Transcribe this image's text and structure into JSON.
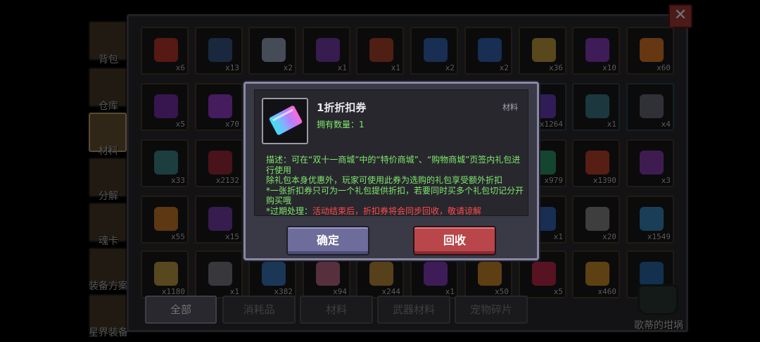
{
  "close_glyph": "✕",
  "side_tabs": [
    {
      "label": "背包",
      "icon": "chest-icon",
      "active": false
    },
    {
      "label": "仓库",
      "icon": "storage-chest-icon",
      "active": false
    },
    {
      "label": "材料",
      "icon": "material-box-icon",
      "active": true
    },
    {
      "label": "分解",
      "icon": "dismantle-icon",
      "active": false
    },
    {
      "label": "魂卡",
      "icon": "soul-card-icon",
      "active": false
    },
    {
      "label": "装备方案",
      "icon": "equipment-plan-icon",
      "active": false
    },
    {
      "label": "星界装备",
      "icon": "astral-gear-icon",
      "active": false
    }
  ],
  "grid_rows": [
    [
      {
        "count": "x6",
        "icon": "red-gem-icon",
        "color": "#c0392b"
      },
      {
        "count": "x13",
        "icon": "banner-icon",
        "color": "#3b5a8a"
      },
      {
        "count": "x2",
        "icon": "scroll-icon",
        "color": "#9aa6c0"
      },
      {
        "count": "x1",
        "icon": "purple-sigil-icon",
        "color": "#7a3fb0"
      },
      {
        "count": "x1",
        "icon": "treasure-chest-icon",
        "color": "#b0452e"
      },
      {
        "count": "x2",
        "icon": "blue-chest-icon",
        "color": "#3567b8"
      },
      {
        "count": "x2",
        "icon": "blue-chest-icon",
        "color": "#3567b8"
      },
      {
        "count": "x36",
        "icon": "gold-medallion-icon",
        "color": "#c8a040"
      },
      {
        "count": "x10",
        "icon": "wizard-hat-icon",
        "color": "#8a3fc0"
      },
      {
        "count": "x60",
        "icon": "campfire-icon",
        "color": "#e07a2a"
      }
    ],
    [
      {
        "count": "x5",
        "icon": "purple-potion-icon",
        "color": "#7a2fb0"
      },
      {
        "count": "x70",
        "icon": "purple-crystal-icon",
        "color": "#9a3fd0"
      },
      {
        "count": "",
        "icon": "empty-icon",
        "color": "#1a1a1c"
      },
      {
        "count": "",
        "icon": "empty-icon",
        "color": "#1a1a1c"
      },
      {
        "count": "",
        "icon": "empty-icon",
        "color": "#1a1a1c"
      },
      {
        "count": "",
        "icon": "empty-icon",
        "color": "#1a1a1c"
      },
      {
        "count": "",
        "icon": "empty-icon",
        "color": "#1a1a1c"
      },
      {
        "count": "x1264",
        "icon": "violet-shard-icon",
        "color": "#6a3fc0"
      },
      {
        "count": "x1",
        "icon": "tablet-icon",
        "color": "#3f7a8a"
      },
      {
        "count": "x4",
        "icon": "machine-icon",
        "color": "#6a6a7a"
      }
    ],
    [
      {
        "count": "x33",
        "icon": "star-jar-icon",
        "color": "#3f8a8a"
      },
      {
        "count": "x2132",
        "icon": "red-ore-icon",
        "color": "#a02a3a"
      },
      {
        "count": "",
        "icon": "empty-icon",
        "color": "#1a1a1c"
      },
      {
        "count": "",
        "icon": "empty-icon",
        "color": "#1a1a1c"
      },
      {
        "count": "",
        "icon": "empty-icon",
        "color": "#1a1a1c"
      },
      {
        "count": "",
        "icon": "empty-icon",
        "color": "#1a1a1c"
      },
      {
        "count": "",
        "icon": "empty-icon",
        "color": "#1a1a1c"
      },
      {
        "count": "x979",
        "icon": "green-gem-icon",
        "color": "#2a9a6a"
      },
      {
        "count": "x1390",
        "icon": "red-rune-icon",
        "color": "#c0452e"
      },
      {
        "count": "x3",
        "icon": "purple-rune-icon",
        "color": "#8a3fb0"
      }
    ],
    [
      {
        "count": "x55",
        "icon": "orange-amulet-icon",
        "color": "#d07a2a"
      },
      {
        "count": "x15",
        "icon": "purple-amulet-icon",
        "color": "#7a3fb0"
      },
      {
        "count": "",
        "icon": "empty-icon",
        "color": "#1a1a1c"
      },
      {
        "count": "",
        "icon": "empty-icon",
        "color": "#1a1a1c"
      },
      {
        "count": "",
        "icon": "empty-icon",
        "color": "#1a1a1c"
      },
      {
        "count": "",
        "icon": "empty-icon",
        "color": "#1a1a1c"
      },
      {
        "count": "",
        "icon": "empty-icon",
        "color": "#1a1a1c"
      },
      {
        "count": "x1",
        "icon": "blue-shard-icon",
        "color": "#3567b8"
      },
      {
        "count": "x20",
        "icon": "pearl-icon",
        "color": "#8a8a8a"
      },
      {
        "count": "x1549",
        "icon": "crystal-cluster-icon",
        "color": "#3a8ac0"
      }
    ],
    [
      {
        "count": "x1180",
        "icon": "gold-star-icon",
        "color": "#c0a040"
      },
      {
        "count": "x1",
        "icon": "gray-crystal-icon",
        "color": "#7a7a86"
      },
      {
        "count": "x382",
        "icon": "blue-ring-icon",
        "color": "#3a7ac0"
      },
      {
        "count": "x94",
        "icon": "pink-petal-icon",
        "color": "#c06a8a"
      },
      {
        "count": "x244",
        "icon": "gold-medal-icon",
        "color": "#c0903a"
      },
      {
        "count": "x1",
        "icon": "purple-flame-icon",
        "color": "#8a3fc0"
      },
      {
        "count": "x50",
        "icon": "orange-star-icon",
        "color": "#d08a2a"
      },
      {
        "count": "x5",
        "icon": "red-crystal-icon",
        "color": "#c02a4a"
      },
      {
        "count": "x460",
        "icon": "amber-shard-icon",
        "color": "#d0902a"
      },
      {
        "count": "",
        "icon": "blue-crystal-icon",
        "color": "#2a6ab0"
      }
    ]
  ],
  "filter_tabs": [
    {
      "label": "全部",
      "active": true
    },
    {
      "label": "消耗品",
      "active": false
    },
    {
      "label": "材料",
      "active": false
    },
    {
      "label": "武器材料",
      "active": false
    },
    {
      "label": "宠物碎片",
      "active": false
    }
  ],
  "npc_label": "歌蒂的坩埚",
  "dialog": {
    "item_name": "1折折扣券",
    "item_type": "材料",
    "owned": "拥有数量：1",
    "desc_line1": "描述：可在“双十一商城”中的“特价商城”、“购物商城”页签内礼包进行使用",
    "desc_line2": "除礼包本身优惠外，玩家可使用此券为选购的礼包享受额外折扣",
    "desc_line3": "*一张折扣券只可为一个礼包提供折扣，若要同时买多个礼包切记分开购买哦",
    "expire_label": "*过期处理：",
    "expire_text": "活动结束后，折扣券将会同步回收，敬请谅解",
    "confirm_label": "确定",
    "recycle_label": "回收",
    "colors": {
      "desc": "#7fe86c",
      "warning": "#ff4b4b",
      "confirm": "#6e6c9a",
      "recycle": "#b8464a"
    }
  }
}
